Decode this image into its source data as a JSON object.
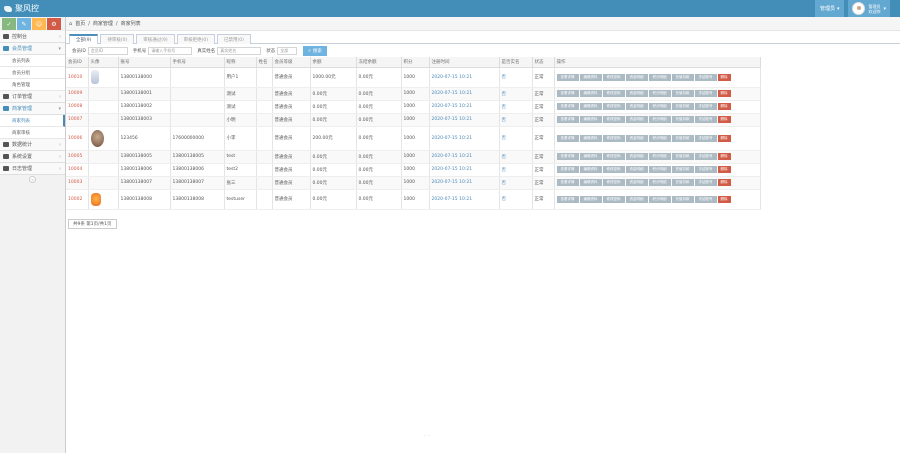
{
  "app": {
    "title": "聚风控"
  },
  "topbar": {
    "menu_label": "管理员",
    "user_name": "管理员",
    "user_sub": "欢迎你"
  },
  "colors": {
    "topbar": "#438eb9",
    "green": "#87b87f",
    "blue": "#6fb3e0",
    "orange": "#ffb752",
    "red": "#d15b47"
  },
  "shortcuts": [
    "check-icon",
    "pencil-icon",
    "users-icon",
    "cogs-icon"
  ],
  "sidebar": {
    "items": [
      {
        "label": "控制台",
        "icon": "dashboard-icon"
      },
      {
        "label": "会员管理",
        "icon": "flag-icon",
        "open": true
      },
      {
        "label": "会员列表",
        "sub": true
      },
      {
        "label": "会员分组",
        "sub": true
      },
      {
        "label": "角色管理",
        "sub": true
      },
      {
        "label": "订单管理",
        "icon": "clock-icon"
      },
      {
        "label": "商家管理",
        "icon": "user-icon",
        "open": true
      },
      {
        "label": "商家列表",
        "sub": true,
        "active": true
      },
      {
        "label": "商家审核",
        "sub": true
      },
      {
        "label": "数据统计",
        "icon": "chart-icon"
      },
      {
        "label": "系统设置",
        "icon": "gear-icon"
      },
      {
        "label": "日志管理",
        "icon": "book-icon"
      }
    ]
  },
  "breadcrumb": [
    "首页",
    "商家管理",
    "商家列表"
  ],
  "tabs": [
    {
      "label": "全部(9)",
      "active": true
    },
    {
      "label": "待审核(0)"
    },
    {
      "label": "审核通过(9)"
    },
    {
      "label": "审核拒绝(0)"
    },
    {
      "label": "已禁用(0)"
    }
  ],
  "filters": [
    {
      "label": "会员ID",
      "placeholder": "会员ID"
    },
    {
      "label": "手机号",
      "placeholder": "请输入手机号"
    },
    {
      "label": "真实姓名",
      "placeholder": "真实姓名"
    },
    {
      "label": "状态",
      "placeholder": "全部"
    }
  ],
  "search_label": "搜索",
  "table": {
    "headers": [
      "会员ID",
      "头像",
      "账号",
      "手机号",
      "昵称",
      "姓名",
      "会员等级",
      "余额",
      "冻结余额",
      "积分",
      "注册时间",
      "是否实名",
      "状态",
      "操作"
    ],
    "rows": [
      {
        "id": "10010",
        "thumb": "bottle",
        "account": "13800138000",
        "phone": "",
        "nick": "用户1",
        "name": "",
        "level": "普通会员",
        "balance": "1000.00元",
        "frozen": "0.00元",
        "points": "1000",
        "time": "2020-07-15 10:21",
        "verified": "否",
        "status": "正常"
      },
      {
        "id": "10009",
        "thumb": "",
        "account": "13800138001",
        "phone": "",
        "nick": "测试",
        "name": "",
        "level": "普通会员",
        "balance": "0.00元",
        "frozen": "0.00元",
        "points": "1000",
        "time": "2020-07-15 10:21",
        "verified": "否",
        "status": "正常"
      },
      {
        "id": "10008",
        "thumb": "",
        "account": "13800138002",
        "phone": "",
        "nick": "测试",
        "name": "",
        "level": "普通会员",
        "balance": "0.00元",
        "frozen": "0.00元",
        "points": "1000",
        "time": "2020-07-15 10:21",
        "verified": "否",
        "status": "正常"
      },
      {
        "id": "10007",
        "thumb": "",
        "account": "13800138003",
        "phone": "",
        "nick": "小明",
        "name": "",
        "level": "普通会员",
        "balance": "0.00元",
        "frozen": "0.00元",
        "points": "1000",
        "time": "2020-07-15 10:21",
        "verified": "否",
        "status": "正常"
      },
      {
        "id": "10006",
        "thumb": "photo",
        "account": "123456",
        "phone": "17600000000",
        "nick": "小李",
        "name": "",
        "level": "普通会员",
        "balance": "200.00元",
        "frozen": "0.00元",
        "points": "1000",
        "time": "2020-07-15 10:21",
        "verified": "否",
        "status": "正常"
      },
      {
        "id": "10005",
        "thumb": "",
        "account": "13800138005",
        "phone": "13800138005",
        "nick": "test",
        "name": "",
        "level": "普通会员",
        "balance": "0.00元",
        "frozen": "0.00元",
        "points": "1000",
        "time": "2020-07-15 10:21",
        "verified": "否",
        "status": "正常"
      },
      {
        "id": "10004",
        "thumb": "",
        "account": "13800138006",
        "phone": "13800138006",
        "nick": "test2",
        "name": "",
        "level": "普通会员",
        "balance": "0.00元",
        "frozen": "0.00元",
        "points": "1000",
        "time": "2020-07-15 10:21",
        "verified": "否",
        "status": "正常"
      },
      {
        "id": "10003",
        "thumb": "",
        "account": "13800138007",
        "phone": "13800138007",
        "nick": "张三",
        "name": "",
        "level": "普通会员",
        "balance": "0.00元",
        "frozen": "0.00元",
        "points": "1000",
        "time": "2020-07-15 10:21",
        "verified": "否",
        "status": "正常"
      },
      {
        "id": "10002",
        "thumb": "orange",
        "account": "13800138008",
        "phone": "13800138008",
        "nick": "testuser",
        "name": "",
        "level": "普通会员",
        "balance": "0.00元",
        "frozen": "0.00元",
        "points": "1000",
        "time": "2020-07-15 10:21",
        "verified": "否",
        "status": "正常"
      }
    ],
    "ops": [
      "查看详情",
      "编辑资料",
      "修改密码",
      "资金明细",
      "积分明细",
      "充值扣款",
      "冻结账号"
    ],
    "delete_label": "删除"
  },
  "footer_button": "共9条 第1页/共1页"
}
